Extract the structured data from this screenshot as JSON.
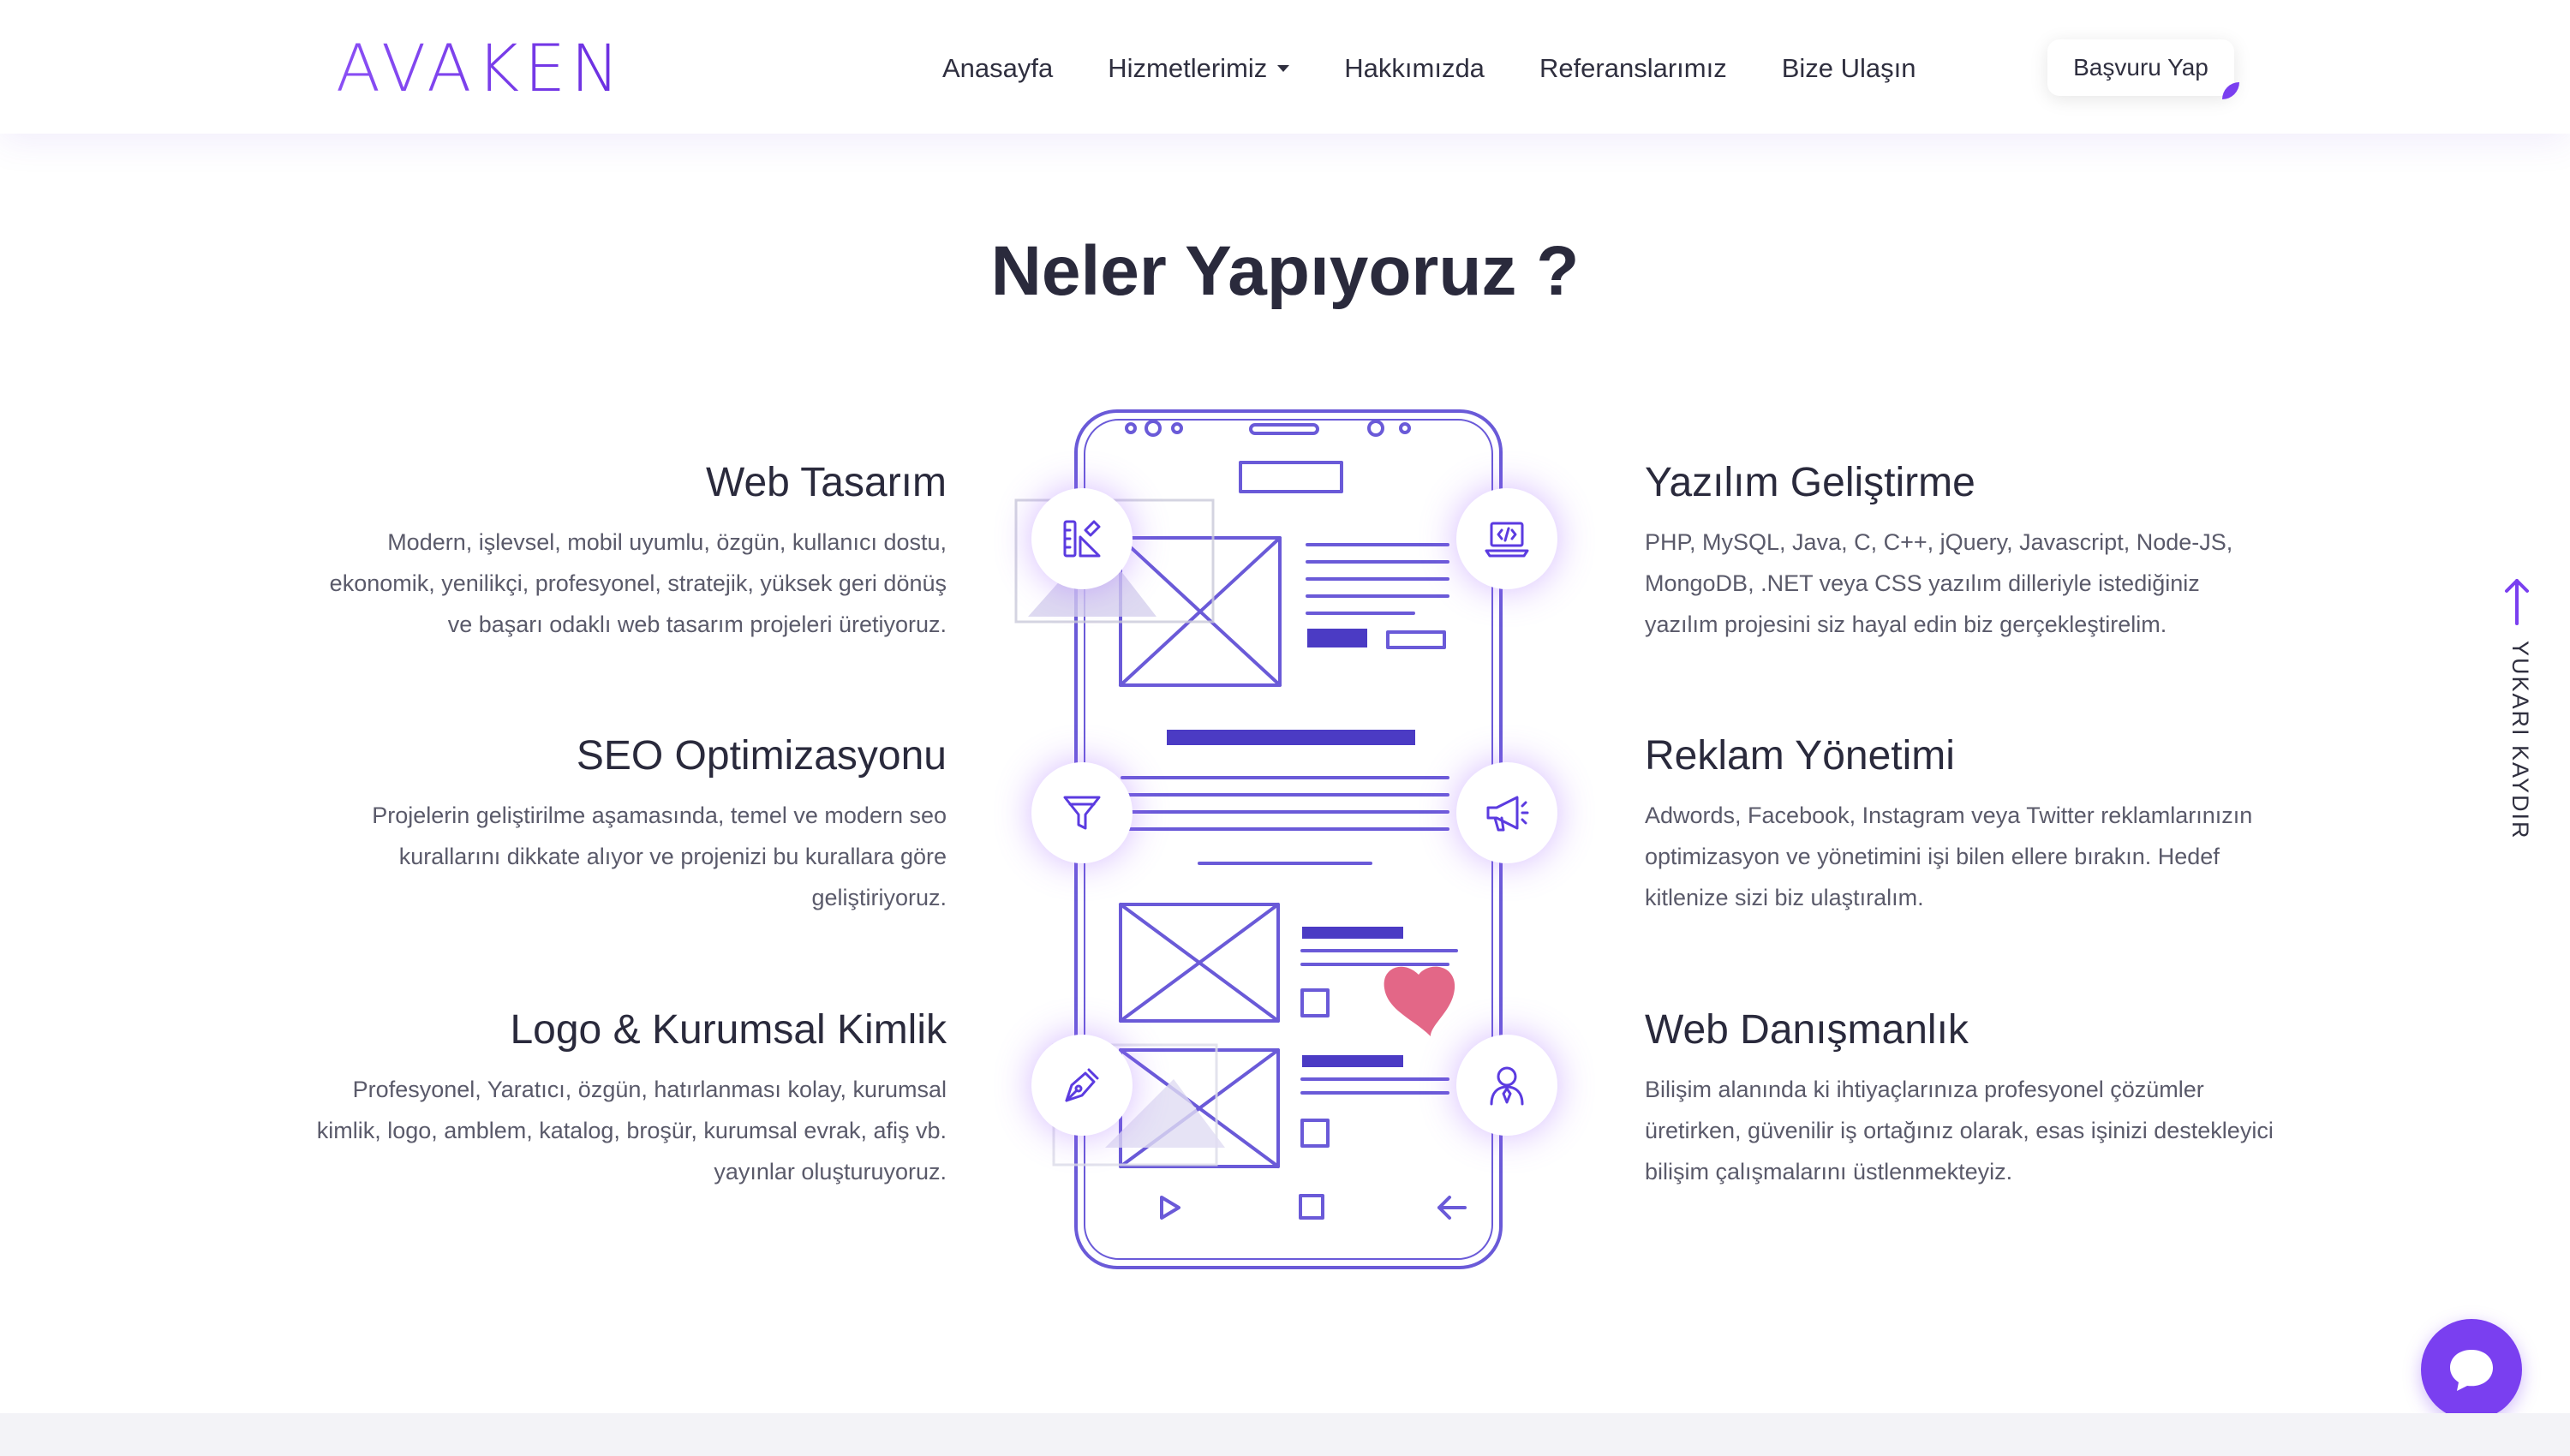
{
  "header": {
    "logo_text": "AVAKEN",
    "nav": [
      {
        "label": "Anasayfa"
      },
      {
        "label": "Hizmetlerimiz",
        "has_dropdown": true
      },
      {
        "label": "Hakkımızda"
      },
      {
        "label": "Referanslarımız"
      },
      {
        "label": "Bize Ulaşın"
      }
    ],
    "apply_button": "Başvuru Yap"
  },
  "section": {
    "title": "Neler Yapıyoruz ?"
  },
  "services_left": [
    {
      "title": "Web Tasarım",
      "text": "Modern, işlevsel, mobil uyumlu, özgün, kullanıcı dostu, ekonomik, yenilikçi, profesyonel, stratejik, yüksek geri dönüş ve başarı odaklı web tasarım projeleri üretiyoruz.",
      "icon": "design-tools-icon"
    },
    {
      "title": "SEO Optimizasyonu",
      "text": "Projelerin geliştirilme aşamasında, temel ve modern seo kurallarını dikkate alıyor ve projenizi bu kurallara göre geliştiriyoruz.",
      "icon": "funnel-icon"
    },
    {
      "title": "Logo & Kurumsal Kimlik",
      "text": "Profesyonel, Yaratıcı, özgün, hatırlanması kolay, kurumsal kimlik, logo, amblem, katalog, broşür, kurumsal evrak, afiş vb. yayınlar oluşturuyoruz.",
      "icon": "pen-nib-icon"
    }
  ],
  "services_right": [
    {
      "title": "Yazılım Geliştirme",
      "text": "PHP, MySQL, Java, C, C++, jQuery, Javascript, Node-JS, MongoDB, .NET veya CSS yazılım dilleriyle istediğiniz yazılım projesini siz hayal edin biz gerçekleştirelim.",
      "icon": "laptop-code-icon"
    },
    {
      "title": "Reklam Yönetimi",
      "text": "Adwords, Facebook, Instagram veya Twitter reklamlarınızın optimizasyon ve yönetimini işi bilen ellere bırakın. Hedef kitlenize sizi biz ulaştıralım.",
      "icon": "megaphone-icon"
    },
    {
      "title": "Web Danışmanlık",
      "text": "Bilişim alanında ki ihtiyaçlarınıza profesyonel çözümler üretirken, güvenilir iş ortağınız olarak, esas işinizi destekleyici bilişim çalışmalarını üstlenmekteyiz.",
      "icon": "consultant-user-icon"
    }
  ],
  "scroll_top": {
    "label": "YUKARI KAYDIR"
  },
  "colors": {
    "accent": "#7a3ff0",
    "wireframe": "#5b4bd0",
    "heart": "#e0567a"
  }
}
